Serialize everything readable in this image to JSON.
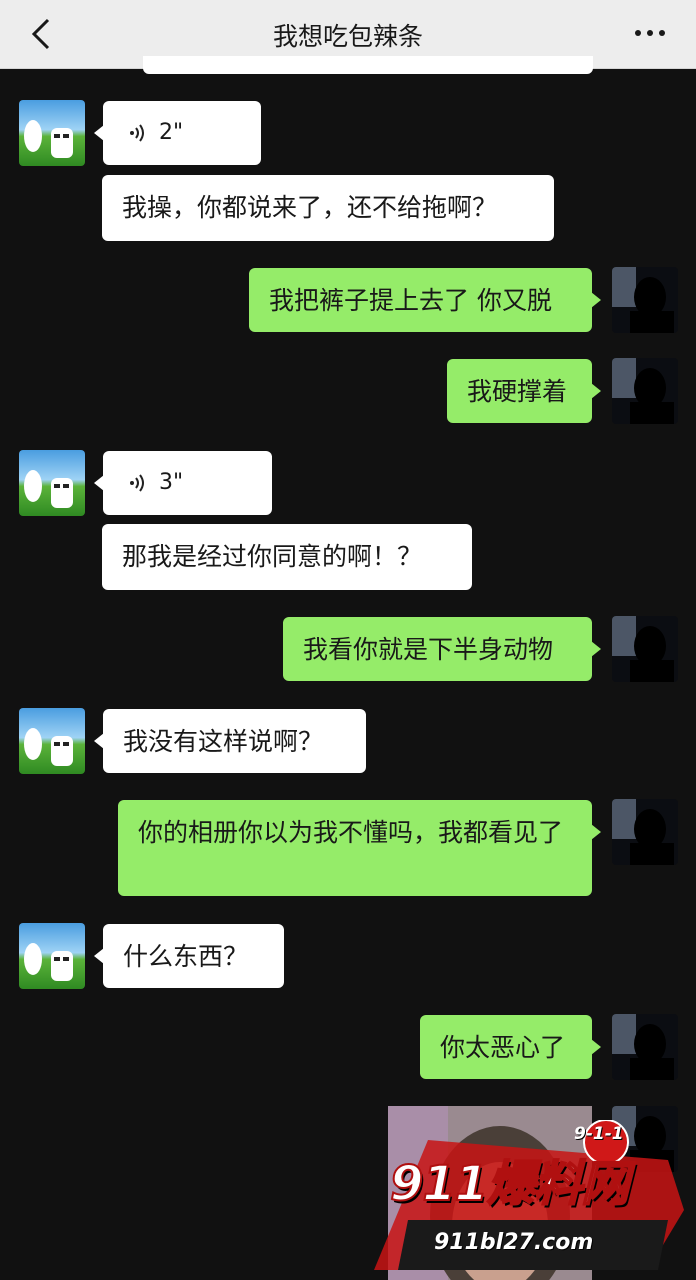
{
  "header": {
    "title": "我想吃包辣条",
    "back_icon": "chevron-left-icon",
    "more_icon": "more-dots-icon"
  },
  "colors": {
    "incoming": "#ffffff",
    "outgoing": "#95ec69",
    "background": "#111111",
    "topbar": "#ededed"
  },
  "messages": [
    {
      "side": "in",
      "type": "voice",
      "duration": "2\""
    },
    {
      "side": "in",
      "type": "text",
      "text": "我操，你都说来了，还不给拖啊？"
    },
    {
      "side": "out",
      "type": "text",
      "text": "我把裤子提上去了 你又脱"
    },
    {
      "side": "out",
      "type": "text",
      "text": "我硬撑着"
    },
    {
      "side": "in",
      "type": "voice",
      "duration": "3\""
    },
    {
      "side": "in",
      "type": "text",
      "text": "那我是经过你同意的啊！？"
    },
    {
      "side": "out",
      "type": "text",
      "text": "我看你就是下半身动物"
    },
    {
      "side": "in",
      "type": "text",
      "text": "我没有这样说啊？"
    },
    {
      "side": "out",
      "type": "text",
      "text": "你的相册你以为我不懂吗，我都看见了"
    },
    {
      "side": "in",
      "type": "text",
      "text": "什么东西？"
    },
    {
      "side": "out",
      "type": "text",
      "text": "你太恶心了"
    },
    {
      "side": "out",
      "type": "image"
    }
  ],
  "watermark": {
    "main": "911爆料网",
    "url": "911bl27.com",
    "badge": "9-1-1"
  }
}
